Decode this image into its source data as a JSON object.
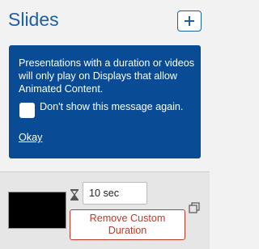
{
  "panel": {
    "title": "Slides",
    "add_button_label": "+"
  },
  "notice": {
    "message": "Presentations with a duration or videos will only play on Displays that allow Animated Content.",
    "checkbox_label": "Don't show this message again.",
    "checkbox_checked": false,
    "okay_label": "Okay",
    "background_color": "#0a4b96"
  },
  "slides": [
    {
      "thumbnail_color": "#000000",
      "duration_value": "10 sec",
      "remove_label": "Remove Custom Duration",
      "duration_icon": "hourglass-icon",
      "copy_icon": "copy-icon"
    }
  ],
  "colors": {
    "accent": "#1d5fa8",
    "danger": "#c0392b"
  }
}
